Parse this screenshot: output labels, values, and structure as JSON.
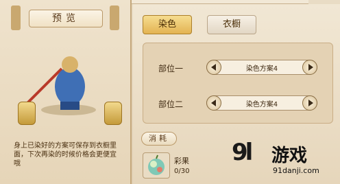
{
  "preview": {
    "title": "预览",
    "description": "身上已染好的方案可保存到衣橱里面，下次再染的时候价格会更便宜哦"
  },
  "tabs": [
    {
      "label": "染色"
    },
    {
      "label": "衣橱"
    }
  ],
  "slots": [
    {
      "label": "部位一",
      "value": "染色方案4"
    },
    {
      "label": "部位二",
      "value": "染色方案4"
    }
  ],
  "consume": {
    "label": "消耗",
    "item_name": "彩果",
    "item_count": "0/30"
  },
  "watermark": {
    "logo": "9l",
    "name": "游戏",
    "url": "91danji.com"
  }
}
